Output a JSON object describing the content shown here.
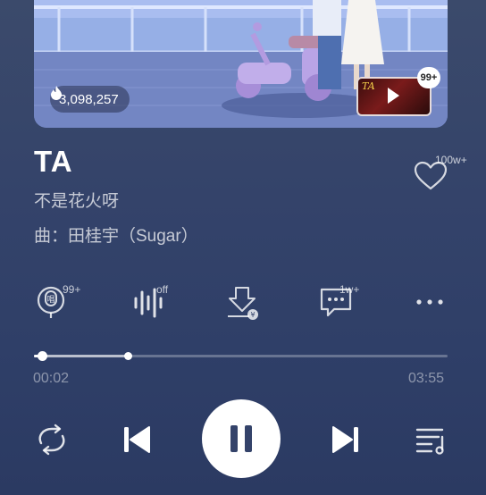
{
  "artwork": {
    "play_count": "3,098,257",
    "mv_thumb_text": "TA",
    "mv_badge": "99+"
  },
  "song": {
    "title": "TA",
    "artist": "不是花火呀",
    "composer": "曲：田桂宇（Sugar）"
  },
  "like": {
    "count": "100w+"
  },
  "actions": {
    "sing_count": "99+",
    "sound_effect": "off",
    "comment_count": "1w+"
  },
  "progress": {
    "current": "00:02",
    "total": "03:55",
    "played_fraction": 0.02,
    "buffered_fraction": 0.23
  },
  "icons": {
    "play_count": "fire-icon",
    "like": "heart-icon",
    "sing": "microphone-icon",
    "sound_effect": "sound-effect-icon",
    "download": "download-icon",
    "comment": "comment-icon",
    "more": "more-icon",
    "loop": "loop-icon",
    "previous": "previous-icon",
    "pause": "pause-icon",
    "next": "next-icon",
    "playlist": "playlist-icon"
  }
}
